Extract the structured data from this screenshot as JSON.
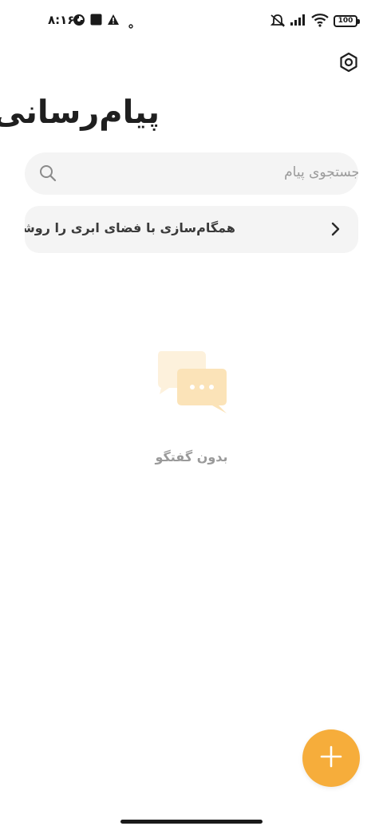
{
  "status_bar": {
    "time": "۸:۱۶",
    "battery": "100",
    "icons": [
      "notification-icon",
      "stop-icon",
      "warning-icon",
      "dot-icon",
      "mute-icon",
      "signal-icon",
      "wifi-icon",
      "battery-icon"
    ]
  },
  "header": {
    "title": "پیام‌رسانی",
    "settings_icon": "settings-icon"
  },
  "search": {
    "placeholder": "جستجوی پیام"
  },
  "sync_banner": {
    "label": "همگام‌سازی با فضای ابری را روشن کنید",
    "chevron_icon": "chevron-right-icon"
  },
  "empty_state": {
    "icon": "chat-bubbles-icon",
    "label": "بدون گفتگو"
  },
  "fab": {
    "icon": "plus-icon"
  },
  "colors": {
    "accent": "#f6ad3b",
    "surface": "#f4f4f4"
  }
}
